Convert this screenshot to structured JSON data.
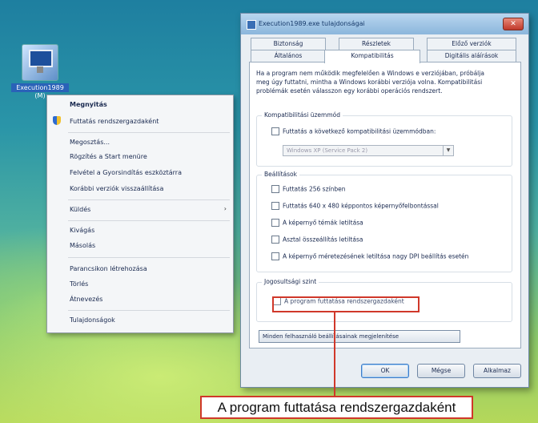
{
  "desktop_icon": {
    "label": "Execution1989",
    "label2": "(M)"
  },
  "context_menu": {
    "items": [
      {
        "label": "Megnyitás",
        "bold": true
      },
      {
        "label": "Futtatás rendszergazdaként",
        "shield": true
      },
      {
        "label": "Megosztás..."
      },
      {
        "label": "Rögzítés a Start menüre"
      },
      {
        "label": "Felvétel a Gyorsindítás eszköztárra"
      },
      {
        "label": "Korábbi verziók visszaállítása"
      },
      {
        "label": "Küldés",
        "submenu": true
      },
      {
        "label": "Kivágás"
      },
      {
        "label": "Másolás"
      },
      {
        "label": "Parancsikon létrehozása"
      },
      {
        "label": "Törlés"
      },
      {
        "label": "Átnevezés"
      },
      {
        "label": "Tulajdonságok"
      }
    ],
    "submenu_arrow": "›"
  },
  "dialog": {
    "title": "Execution1989.exe tulajdonságai",
    "close_label": "✕",
    "tabs_row1": [
      "Biztonság",
      "Részletek",
      "Előző verziók"
    ],
    "tabs_row2": [
      "Általános",
      "Kompatibilitás",
      "Digitális aláírások"
    ],
    "intro": "Ha a program nem működik megfelelően a Windows e verziójában, próbálja meg úgy futtatni, mintha a Windows korábbi verziója volna. Kompatibilitási problémák esetén válasszon egy korábbi operációs rendszert.",
    "group_compat": {
      "title": "Kompatibilitási üzemmód",
      "checkbox": "Futtatás a következő kompatibilitási üzemmódban:",
      "select_value": "Windows XP (Service Pack 2)",
      "select_arrow": "▼"
    },
    "group_settings": {
      "title": "Beállítások",
      "checkboxes": [
        "Futtatás 256 színben",
        "Futtatás 640 x 480 képpontos képernyőfelbontással",
        "A képernyő témák letiltása",
        "Asztal összeállítás letiltása",
        "A képernyő méretezésének letiltása nagy DPI beállítás esetén"
      ]
    },
    "group_privilege": {
      "title": "Jogosultsági szint",
      "checkbox": "A program futtatása rendszergazdaként"
    },
    "all_users_button": "Minden felhasználó beállításainak megjelenítése",
    "buttons": {
      "ok": "OK",
      "cancel": "Mégse",
      "apply": "Alkalmaz"
    }
  },
  "callout": {
    "text": "A program futtatása rendszergazdaként"
  },
  "colors": {
    "highlight": "#d0382a",
    "dialog_bg": "#e9eef3",
    "title_bar": "#8bb6dc"
  }
}
